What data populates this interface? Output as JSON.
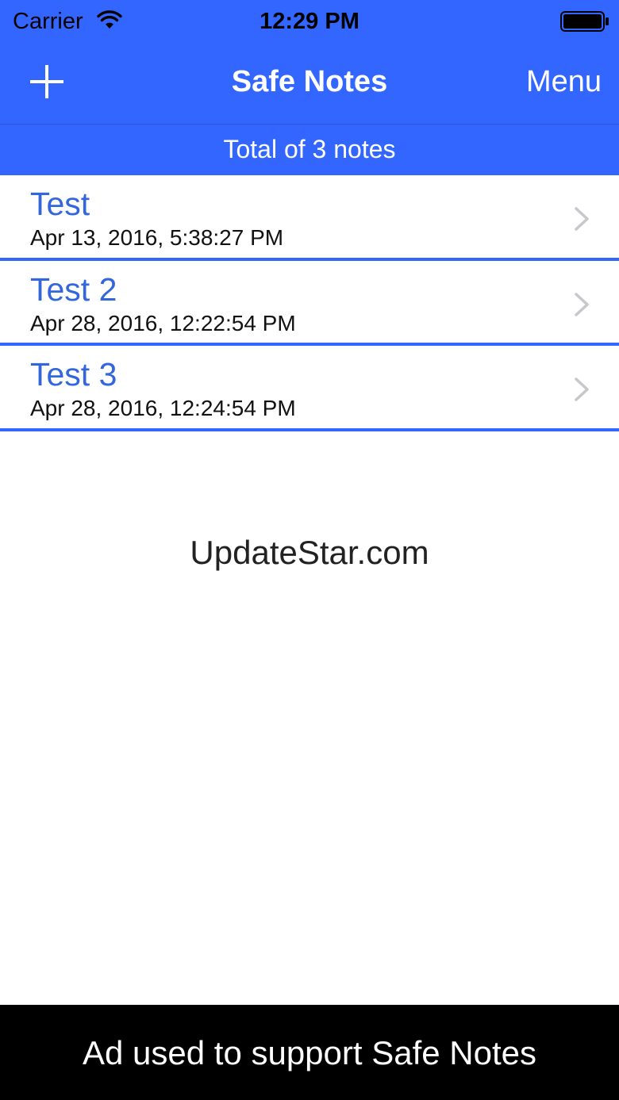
{
  "status_bar": {
    "carrier": "Carrier",
    "time": "12:29 PM",
    "icons": [
      "wifi-icon",
      "battery-icon"
    ]
  },
  "nav_bar": {
    "add_icon": "plus-icon",
    "title": "Safe Notes",
    "menu_label": "Menu"
  },
  "total": {
    "text": "Total of 3 notes"
  },
  "notes": [
    {
      "title": "Test",
      "date": "Apr 13, 2016, 5:38:27 PM"
    },
    {
      "title": "Test 2",
      "date": "Apr 28, 2016, 12:22:54 PM"
    },
    {
      "title": "Test 3",
      "date": "Apr 28, 2016, 12:24:54 PM"
    }
  ],
  "watermark": "UpdateStar.com",
  "ad": {
    "text": "Ad used to support Safe Notes"
  },
  "colors": {
    "header_blue": "#3366ff",
    "note_title_blue": "#3366dd",
    "ad_background": "#000000"
  }
}
